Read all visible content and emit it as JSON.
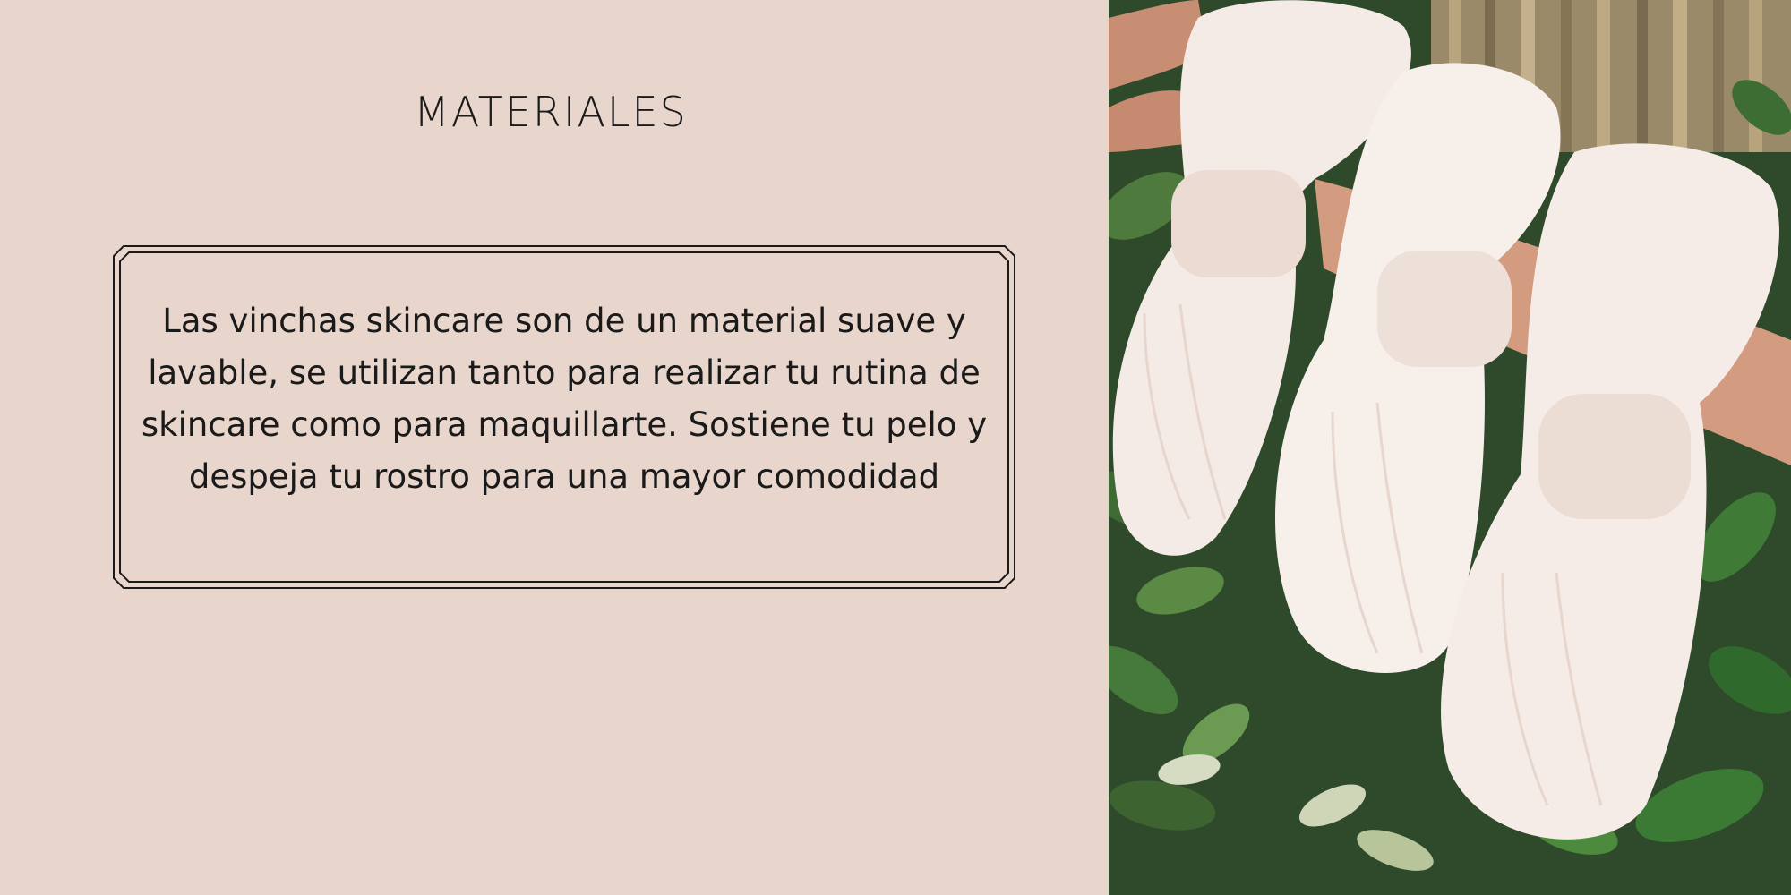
{
  "slide": {
    "title": "MATERIALES",
    "body": "Las vinchas skincare son de un material suave y lavable, se utilizan tanto para realizar tu rutina de skincare como para maquillarte. Sostiene tu pelo y despeja tu rostro para una mayor comodidad"
  },
  "photo": {
    "subject": "white-terry-bow-headbands"
  },
  "colors": {
    "background": "#e8d5cc",
    "text": "#1a1a1a",
    "foliage": "#2f4a2c",
    "headband": "#f6ede8"
  }
}
